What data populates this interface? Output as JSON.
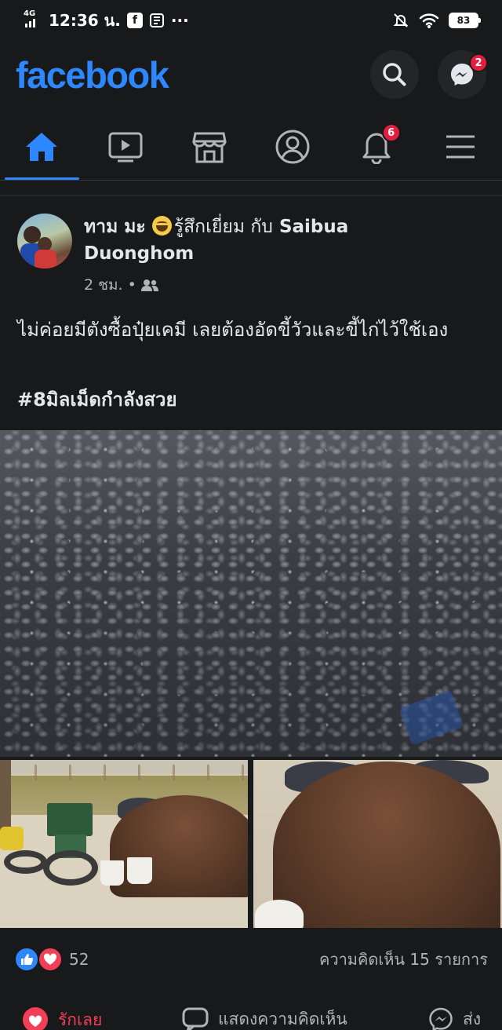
{
  "status_bar": {
    "network": "4G",
    "time": "12:36 น.",
    "notif_icons": [
      "facebook-app-icon",
      "sim-icon"
    ],
    "more": "···",
    "battery": "83"
  },
  "header": {
    "logo": "facebook",
    "messenger_badge": "2"
  },
  "tabs": [
    {
      "name": "home",
      "active": true
    },
    {
      "name": "watch",
      "active": false
    },
    {
      "name": "marketplace",
      "active": false
    },
    {
      "name": "profile",
      "active": false
    },
    {
      "name": "notifications",
      "active": false,
      "badge": "6"
    },
    {
      "name": "menu",
      "active": false
    }
  ],
  "post": {
    "author": "ทาม มะ",
    "feeling": "รู้สึกเยี่ยม กับ",
    "tagged_line1": "Saibua",
    "tagged_line2": "Duonghom",
    "time": "2 ชม. •",
    "text": "ไม่ค่อยมีตังซื้อปุ๋ยเคมี เลยต้องอัดขี้วัวและขี้ไก่ไว้ใช้เอง",
    "hashtag": "#8มิลเม็ดกำลังสวย"
  },
  "reactions": {
    "count": "52",
    "comments": "ความคิดเห็น 15 รายการ"
  },
  "actions": {
    "love": "รักเลย",
    "comment": "แสดงความคิดเห็น",
    "share": "ส่ง"
  },
  "colors": {
    "background": "#18191a",
    "brand_blue": "#2d88ff",
    "badge_red": "#e41e3f",
    "love_red": "#f33e58",
    "text_primary": "#e4e6eb",
    "text_secondary": "#b0b3b8"
  }
}
